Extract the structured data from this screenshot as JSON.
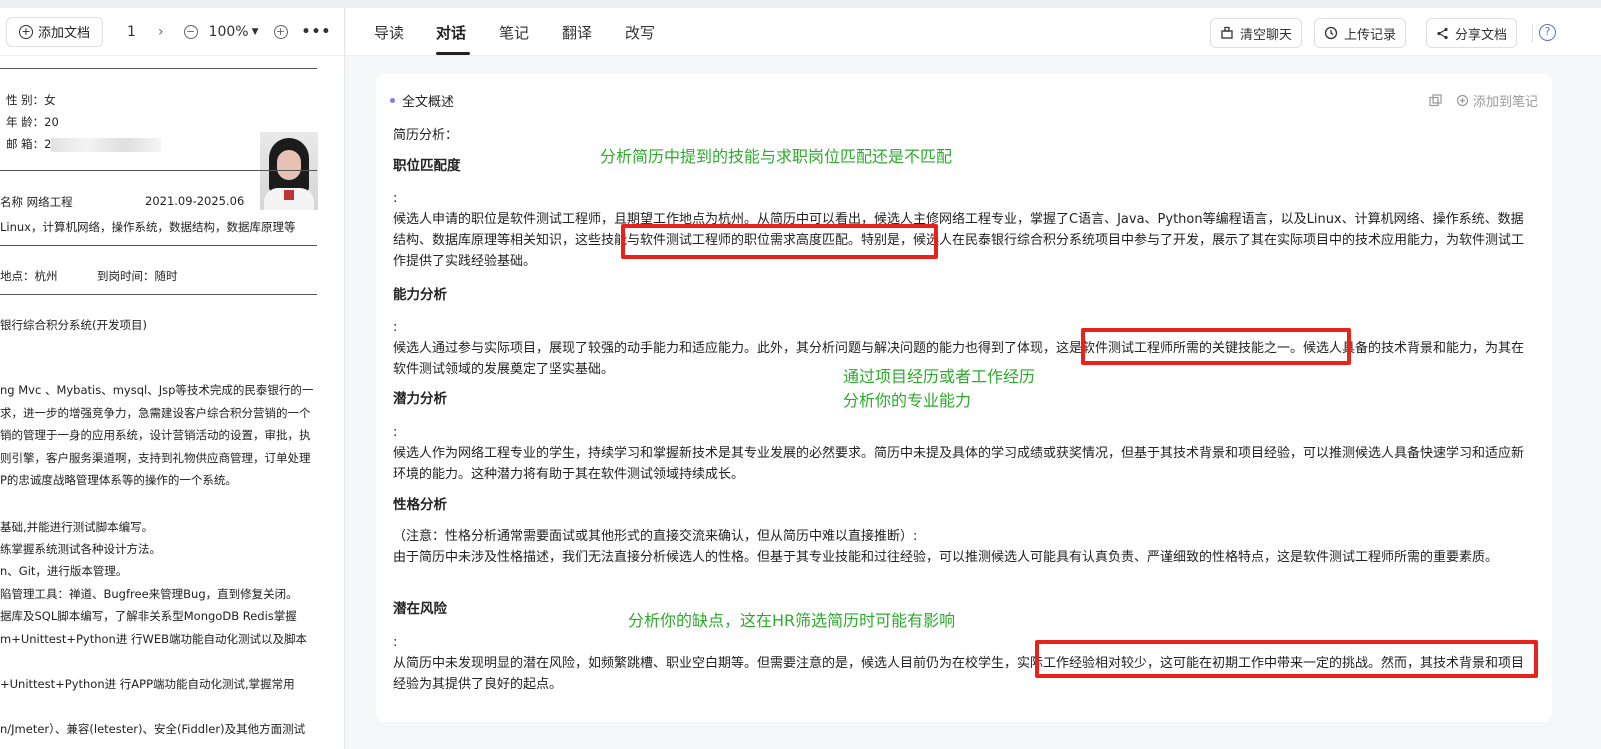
{
  "left_toolbar": {
    "add_doc": "添加文档",
    "page": "1",
    "zoom": "100%"
  },
  "resume": {
    "gender": "性 别：女",
    "age": "年 龄：20",
    "email": "邮 箱：2",
    "edu_name": "名称 网络工程",
    "edu_date": "2021.09-2025.06",
    "courses": "Linux，计算机网络，操作系统，数据结构，数据库原理等",
    "location": "地点：杭州",
    "arrival": "到岗时间：随时",
    "project": "银行综合积分系统(开发项目)",
    "lines": [
      "ng Mvc 、Mybatis、mysql、Jsp等技术完成的民泰银行的一",
      "求，进一步的增强竞争力，急需建设客户综合积分营销的一个",
      "销的管理于一身的应用系统，设计营销活动的设置，审批，执",
      "则引擎，客户服务渠道啊，支持到礼物供应商管理，订单处理",
      "P的忠诚度战略管理体系等的操作的一个系统。"
    ],
    "skills": [
      "基础,并能进行测试脚本编写。",
      "练掌握系统测试各种设计方法。",
      "n、Git，进行版本管理。",
      "陷管理工具：禅道、Bugfree来管理Bug，直到修复关闭。",
      "据库及SQL脚本编写，了解非关系型MongoDB Redis掌握",
      "m+Unittest+Python进 行WEB端功能自动化测试以及脚本",
      "+Unittest+Python进 行APP端功能自动化测试,掌握常用",
      "n/Jmeter）、兼容(letester)、安全(Fiddler)及其他方面测试"
    ]
  },
  "tabs": [
    "导读",
    "对话",
    "笔记",
    "翻译",
    "改写"
  ],
  "actions": {
    "clear": "清空聊天",
    "history": "上传记录",
    "share": "分享文档"
  },
  "card": {
    "summary_title": "全文概述",
    "add_note": "添加到笔记",
    "intro": "简历分析：",
    "sections": [
      {
        "title": "职位匹配度",
        "colon": ":",
        "text": "候选人申请的职位是软件测试工程师，且期望工作地点为杭州。从简历中可以看出，候选人主修网络工程专业，掌握了C语言、Java、Python等编程语言，以及Linux、计算机网络、操作系统、数据结构、数据库原理等相关知识，这些技能与软件测试工程师的职位需求高度匹配。特别是，候选人在民泰银行综合积分系统项目中参与了开发，展示了其在实际项目中的技术应用能力，为软件测试工作提供了实践经验基础。"
      },
      {
        "title": "能力分析",
        "colon": ":",
        "text": "候选人通过参与实际项目，展现了较强的动手能力和适应能力。此外，其分析问题与解决问题的能力也得到了体现，这是软件测试工程师所需的关键技能之一。候选人具备的技术背景和能力，为其在软件测试领域的发展奠定了坚实基础。"
      },
      {
        "title": "潜力分析",
        "colon": ":",
        "text": "候选人作为网络工程专业的学生，持续学习和掌握新技术是其专业发展的必然要求。简历中未提及具体的学习成绩或获奖情况，但基于其技术背景和项目经验，可以推测候选人具备快速学习和适应新环境的能力。这种潜力将有助于其在软件测试领域持续成长。"
      },
      {
        "title": "性格分析",
        "colon": "（注意：性格分析通常需要面试或其他形式的直接交流来确认，但从简历中难以直接推断）:",
        "text": "由于简历中未涉及性格描述，我们无法直接分析候选人的性格。但基于其专业技能和过往经验，可以推测候选人可能具有认真负责、严谨细致的性格特点，这是软件测试工程师所需的重要素质。"
      },
      {
        "title": "潜在风险",
        "colon": ":",
        "text": "从简历中未发现明显的潜在风险，如频繁跳槽、职业空白期等。但需要注意的是，候选人目前仍为在校学生，实际工作经验相对较少，这可能在初期工作中带来一定的挑战。然而，其技术背景和项目经验为其提供了良好的起点。"
      }
    ]
  },
  "annotations": {
    "a1": "分析简历中提到的技能与求职岗位匹配还是不匹配",
    "a2_line1": "通过项目经历或者工作经历",
    "a2_line2": "分析你的专业能力",
    "a3": "分析你的缺点，这在HR筛选简历时可能有影响"
  },
  "colors": {
    "annotation": "#2eaa2e",
    "highlight_box": "#e8231c",
    "accent_dot": "#7a7fe8"
  }
}
